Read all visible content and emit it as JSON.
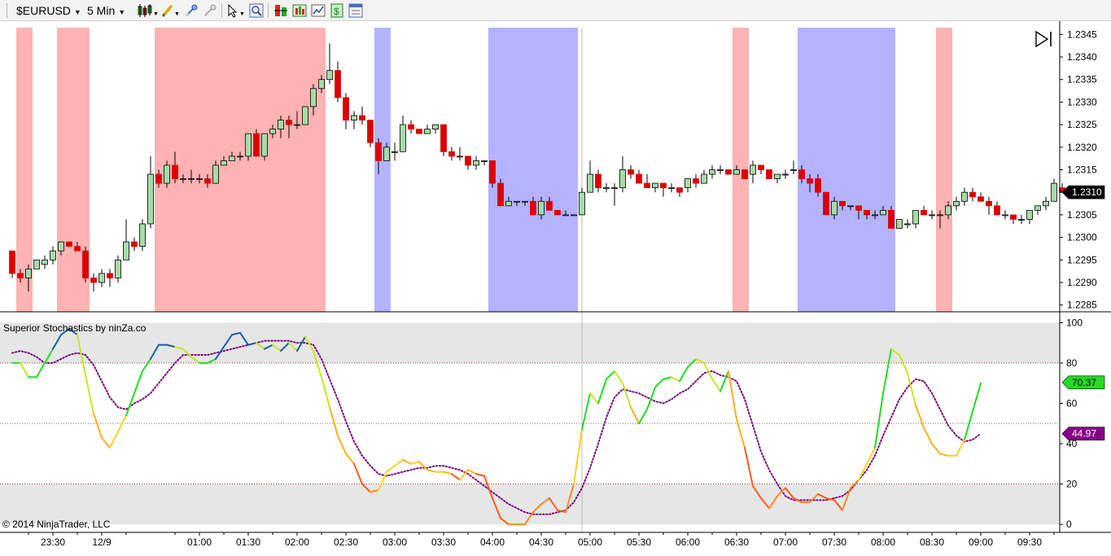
{
  "toolbar": {
    "instrument": "$EURUSD",
    "interval": "5 Min",
    "icons": [
      "bars-type-icon",
      "draw-tool-icon",
      "zoom-in-icon",
      "zoom-out-icon",
      "cursor-icon",
      "magnify-icon",
      "data-box-icon",
      "indicators-icon",
      "chart-style-icon",
      "strategy-icon",
      "properties-icon"
    ]
  },
  "colors": {
    "bull_fill": "#a6dca6",
    "bear_fill": "#dd0000",
    "pink_band": "#ffb3b3",
    "blue_band": "#b3b3ff",
    "zone_fill": "#e6e6e6",
    "signal_line": "#7a0a7a",
    "price_tag": "#000000",
    "k_tag": "#22dd22",
    "d_tag": "#880088"
  },
  "price_panel": {
    "y_labels": [
      "1.2345",
      "1.2340",
      "1.2335",
      "1.2330",
      "1.2325",
      "1.2320",
      "1.2315",
      "1.2310",
      "1.2305",
      "1.2300",
      "1.2295",
      "1.2290",
      "1.2285"
    ],
    "y_range": [
      1.22835,
      1.23465
    ],
    "current_price": "1.2310",
    "candles": [
      [
        1.2297,
        1.2297,
        1.2291,
        1.2292
      ],
      [
        1.2292,
        1.2293,
        1.229,
        1.2291
      ],
      [
        1.2291,
        1.2294,
        1.2288,
        1.2293
      ],
      [
        1.2293,
        1.2295,
        1.2293,
        1.2295
      ],
      [
        1.2294,
        1.2296,
        1.2293,
        1.2295
      ],
      [
        1.2295,
        1.2298,
        1.2294,
        1.2297
      ],
      [
        1.2297,
        1.2299,
        1.2296,
        1.2299
      ],
      [
        1.2299,
        1.2299,
        1.2298,
        1.2298
      ],
      [
        1.2298,
        1.2299,
        1.2297,
        1.2297
      ],
      [
        1.2297,
        1.2298,
        1.229,
        1.2291
      ],
      [
        1.2291,
        1.2292,
        1.2288,
        1.229
      ],
      [
        1.229,
        1.2293,
        1.2289,
        1.2292
      ],
      [
        1.2292,
        1.2293,
        1.2289,
        1.2291
      ],
      [
        1.2291,
        1.2296,
        1.229,
        1.2295
      ],
      [
        1.2295,
        1.2304,
        1.2295,
        1.2299
      ],
      [
        1.2299,
        1.23,
        1.2297,
        1.2298
      ],
      [
        1.2298,
        1.2304,
        1.2297,
        1.2303
      ],
      [
        1.2303,
        1.2318,
        1.2302,
        1.2314
      ],
      [
        1.2314,
        1.2315,
        1.2311,
        1.2312
      ],
      [
        1.2312,
        1.2317,
        1.2311,
        1.2316
      ],
      [
        1.2316,
        1.2319,
        1.2312,
        1.2313
      ],
      [
        1.2313,
        1.2314,
        1.2312,
        1.2313
      ],
      [
        1.2313,
        1.2315,
        1.2312,
        1.2313
      ],
      [
        1.2313,
        1.2314,
        1.2312,
        1.2313
      ],
      [
        1.2313,
        1.2314,
        1.2311,
        1.2312
      ],
      [
        1.2312,
        1.2317,
        1.2312,
        1.2316
      ],
      [
        1.2316,
        1.2318,
        1.2316,
        1.2317
      ],
      [
        1.2317,
        1.2319,
        1.2317,
        1.2318
      ],
      [
        1.2318,
        1.2319,
        1.2317,
        1.2318
      ],
      [
        1.2318,
        1.2323,
        1.2317,
        1.2323
      ],
      [
        1.2323,
        1.2324,
        1.2318,
        1.2318
      ],
      [
        1.2318,
        1.2323,
        1.2317,
        1.2323
      ],
      [
        1.2323,
        1.2325,
        1.2322,
        1.2324
      ],
      [
        1.2324,
        1.2327,
        1.2322,
        1.2326
      ],
      [
        1.2326,
        1.2327,
        1.2322,
        1.2325
      ],
      [
        1.2325,
        1.2328,
        1.2324,
        1.2325
      ],
      [
        1.2325,
        1.2329,
        1.2325,
        1.2329
      ],
      [
        1.2329,
        1.2334,
        1.2327,
        1.2333
      ],
      [
        1.2333,
        1.2336,
        1.2332,
        1.2335
      ],
      [
        1.2335,
        1.2343,
        1.2334,
        1.2337
      ],
      [
        1.2337,
        1.2339,
        1.233,
        1.2331
      ],
      [
        1.2331,
        1.2332,
        1.2324,
        1.2326
      ],
      [
        1.2326,
        1.2328,
        1.2324,
        1.2327
      ],
      [
        1.2327,
        1.2329,
        1.2325,
        1.2326
      ],
      [
        1.2326,
        1.2326,
        1.232,
        1.2321
      ],
      [
        1.2321,
        1.2322,
        1.2314,
        1.2317
      ],
      [
        1.2317,
        1.2321,
        1.2317,
        1.232
      ],
      [
        1.2319,
        1.2321,
        1.2317,
        1.2319
      ],
      [
        1.2319,
        1.2327,
        1.2319,
        1.2325
      ],
      [
        1.2325,
        1.2326,
        1.2323,
        1.2324
      ],
      [
        1.2324,
        1.2324,
        1.2323,
        1.2323
      ],
      [
        1.2323,
        1.2325,
        1.2323,
        1.2324
      ],
      [
        1.2324,
        1.2325,
        1.2323,
        1.2325
      ],
      [
        1.2325,
        1.2325,
        1.2318,
        1.2319
      ],
      [
        1.2319,
        1.232,
        1.2317,
        1.2318
      ],
      [
        1.2318,
        1.232,
        1.2317,
        1.2318
      ],
      [
        1.2318,
        1.2318,
        1.2315,
        1.2316
      ],
      [
        1.2316,
        1.2318,
        1.2315,
        1.2317
      ],
      [
        1.2317,
        1.2317,
        1.2316,
        1.2317
      ],
      [
        1.2317,
        1.2317,
        1.2311,
        1.2312
      ],
      [
        1.2312,
        1.2313,
        1.2307,
        1.2307
      ],
      [
        1.2307,
        1.2309,
        1.2307,
        1.2308
      ],
      [
        1.2308,
        1.2308,
        1.2307,
        1.2308
      ],
      [
        1.2308,
        1.2308,
        1.2307,
        1.2308
      ],
      [
        1.2308,
        1.2309,
        1.2305,
        1.2305
      ],
      [
        1.2305,
        1.2309,
        1.2304,
        1.2308
      ],
      [
        1.2308,
        1.2309,
        1.2306,
        1.2306
      ],
      [
        1.2306,
        1.2306,
        1.2305,
        1.2305
      ],
      [
        1.2305,
        1.2306,
        1.2305,
        1.2305
      ],
      [
        1.2305,
        1.2305,
        1.2305,
        1.2305
      ],
      [
        1.2305,
        1.2311,
        1.2305,
        1.231
      ],
      [
        1.231,
        1.2317,
        1.231,
        1.2314
      ],
      [
        1.2314,
        1.2315,
        1.231,
        1.2311
      ],
      [
        1.2311,
        1.2312,
        1.231,
        1.2311
      ],
      [
        1.2311,
        1.2312,
        1.2307,
        1.2311
      ],
      [
        1.2311,
        1.2318,
        1.231,
        1.2315
      ],
      [
        1.2315,
        1.2316,
        1.2313,
        1.2314
      ],
      [
        1.2314,
        1.2315,
        1.2312,
        1.2312
      ],
      [
        1.2312,
        1.2314,
        1.2311,
        1.2311
      ],
      [
        1.2311,
        1.2312,
        1.231,
        1.2312
      ],
      [
        1.2312,
        1.2312,
        1.2309,
        1.2311
      ],
      [
        1.2311,
        1.2312,
        1.231,
        1.2311
      ],
      [
        1.2311,
        1.2311,
        1.2309,
        1.231
      ],
      [
        1.2311,
        1.2313,
        1.231,
        1.2313
      ],
      [
        1.2313,
        1.2314,
        1.2311,
        1.2312
      ],
      [
        1.2312,
        1.2315,
        1.2312,
        1.2314
      ],
      [
        1.2314,
        1.2316,
        1.2313,
        1.2315
      ],
      [
        1.2315,
        1.2316,
        1.2314,
        1.2315
      ],
      [
        1.2315,
        1.2315,
        1.2314,
        1.2314
      ],
      [
        1.2314,
        1.2316,
        1.2314,
        1.2315
      ],
      [
        1.2315,
        1.2315,
        1.2313,
        1.2313
      ],
      [
        1.2314,
        1.2317,
        1.2312,
        1.2316
      ],
      [
        1.2316,
        1.2316,
        1.2314,
        1.2315
      ],
      [
        1.2315,
        1.2315,
        1.2313,
        1.2313
      ],
      [
        1.2313,
        1.2314,
        1.2312,
        1.2314
      ],
      [
        1.2314,
        1.2315,
        1.2313,
        1.2314
      ],
      [
        1.2315,
        1.2317,
        1.2314,
        1.2315
      ],
      [
        1.2315,
        1.2316,
        1.2312,
        1.2313
      ],
      [
        1.2313,
        1.2314,
        1.231,
        1.2312
      ],
      [
        1.2313,
        1.2314,
        1.2309,
        1.231
      ],
      [
        1.231,
        1.231,
        1.2305,
        1.2305
      ],
      [
        1.2305,
        1.2309,
        1.2304,
        1.2308
      ],
      [
        1.2308,
        1.2308,
        1.2306,
        1.2307
      ],
      [
        1.2307,
        1.2307,
        1.2306,
        1.2307
      ],
      [
        1.2307,
        1.2307,
        1.2304,
        1.2306
      ],
      [
        1.2306,
        1.2306,
        1.2304,
        1.2305
      ],
      [
        1.2305,
        1.2306,
        1.2304,
        1.2305
      ],
      [
        1.2305,
        1.2307,
        1.2305,
        1.2306
      ],
      [
        1.2306,
        1.2307,
        1.2302,
        1.2302
      ],
      [
        1.2302,
        1.2304,
        1.2302,
        1.2304
      ],
      [
        1.2303,
        1.2304,
        1.2302,
        1.2303
      ],
      [
        1.2303,
        1.2306,
        1.2302,
        1.2306
      ],
      [
        1.2306,
        1.2307,
        1.2305,
        1.2305
      ],
      [
        1.2305,
        1.2306,
        1.2304,
        1.2305
      ],
      [
        1.2305,
        1.2306,
        1.2302,
        1.2305
      ],
      [
        1.2305,
        1.2308,
        1.2304,
        1.2307
      ],
      [
        1.2307,
        1.2309,
        1.2306,
        1.2308
      ],
      [
        1.2308,
        1.2311,
        1.2307,
        1.231
      ],
      [
        1.231,
        1.2311,
        1.2308,
        1.2309
      ],
      [
        1.2309,
        1.231,
        1.2308,
        1.2308
      ],
      [
        1.2308,
        1.2309,
        1.2305,
        1.2307
      ],
      [
        1.2307,
        1.2308,
        1.2305,
        1.2305
      ],
      [
        1.2305,
        1.2306,
        1.2304,
        1.2305
      ],
      [
        1.2305,
        1.2305,
        1.2303,
        1.2304
      ],
      [
        1.2304,
        1.2305,
        1.2303,
        1.2304
      ],
      [
        1.2304,
        1.2306,
        1.2303,
        1.2306
      ],
      [
        1.2306,
        1.2307,
        1.2305,
        1.2307
      ],
      [
        1.2307,
        1.2309,
        1.2306,
        1.2308
      ],
      [
        1.2308,
        1.2313,
        1.2308,
        1.2312
      ],
      [
        1.2311,
        1.2312,
        1.231,
        1.231
      ]
    ]
  },
  "bands": [
    {
      "from": 1,
      "to": 2,
      "color": "pink"
    },
    {
      "from": 6,
      "to": 9,
      "color": "pink"
    },
    {
      "from": 18,
      "to": 38,
      "color": "pink"
    },
    {
      "from": 45,
      "to": 46,
      "color": "blue"
    },
    {
      "from": 59,
      "to": 69,
      "color": "blue"
    },
    {
      "from": 89,
      "to": 90,
      "color": "pink"
    },
    {
      "from": 97,
      "to": 108,
      "color": "blue"
    },
    {
      "from": 114,
      "to": 115,
      "color": "pink"
    }
  ],
  "indicator_panel": {
    "title": "Superior Stochastics by ninZa.co",
    "y_labels": [
      "100",
      "80",
      "60",
      "40",
      "20",
      "0"
    ],
    "y_range": [
      -4,
      105
    ],
    "k_value": "70.37",
    "d_value": "44.97",
    "k": [
      80,
      80,
      73,
      73,
      80,
      87,
      94,
      97,
      94,
      74,
      55,
      43,
      38,
      46,
      54,
      65,
      76,
      82,
      89,
      89,
      88,
      87,
      83,
      80,
      80,
      82,
      88,
      94,
      95,
      89,
      90,
      87,
      89,
      86,
      90,
      86,
      93,
      86,
      73,
      58,
      44,
      35,
      30,
      20,
      16,
      17,
      26,
      29,
      32,
      30,
      31,
      27,
      26,
      26,
      25,
      22,
      27,
      25,
      24,
      13,
      3,
      0,
      0,
      0,
      6,
      10,
      13,
      7,
      6,
      20,
      47,
      65,
      60,
      72,
      76,
      70,
      58,
      50,
      57,
      68,
      72,
      73,
      71,
      78,
      82,
      80,
      72,
      66,
      76,
      52,
      38,
      19,
      13,
      8,
      14,
      18,
      13,
      11,
      11,
      15,
      13,
      12,
      7,
      18,
      22,
      30,
      38,
      65,
      87,
      84,
      75,
      59,
      48,
      40,
      35,
      34,
      34,
      42,
      56,
      70
    ],
    "d": [
      85,
      86,
      85,
      83,
      80,
      80,
      82,
      84,
      85,
      84,
      79,
      71,
      63,
      58,
      57,
      60,
      62,
      65,
      70,
      75,
      80,
      84,
      84,
      84,
      84,
      85,
      86,
      87,
      88,
      89,
      90,
      91,
      91,
      91,
      91,
      90,
      90,
      89,
      82,
      72,
      62,
      51,
      41,
      34,
      29,
      25,
      24,
      25,
      26,
      27,
      28,
      28,
      29,
      29,
      28,
      27,
      25,
      22,
      19,
      16,
      13,
      10,
      8,
      6,
      5,
      5,
      5,
      6,
      7,
      11,
      18,
      28,
      40,
      53,
      63,
      67,
      66,
      65,
      63,
      61,
      60,
      62,
      65,
      67,
      71,
      75,
      76,
      74,
      73,
      71,
      62,
      49,
      36,
      27,
      20,
      14,
      12,
      12,
      12,
      12,
      12,
      13,
      14,
      17,
      22,
      27,
      34,
      44,
      53,
      62,
      68,
      72,
      71,
      65,
      57,
      49,
      44,
      41,
      42,
      45
    ]
  },
  "x_labels": [
    {
      "i": 5,
      "t": "23:30"
    },
    {
      "i": 11,
      "t": "12/9"
    },
    {
      "i": 23,
      "t": "01:00"
    },
    {
      "i": 29,
      "t": "01:30"
    },
    {
      "i": 35,
      "t": "02:00"
    },
    {
      "i": 41,
      "t": "02:30"
    },
    {
      "i": 47,
      "t": "03:00"
    },
    {
      "i": 53,
      "t": "03:30"
    },
    {
      "i": 59,
      "t": "04:00"
    },
    {
      "i": 65,
      "t": "04:30"
    },
    {
      "i": 71,
      "t": "05:00"
    },
    {
      "i": 77,
      "t": "05:30"
    },
    {
      "i": 83,
      "t": "06:00"
    },
    {
      "i": 89,
      "t": "06:30"
    },
    {
      "i": 95,
      "t": "07:00"
    },
    {
      "i": 101,
      "t": "07:30"
    },
    {
      "i": 107,
      "t": "08:00"
    },
    {
      "i": 113,
      "t": "08:30"
    },
    {
      "i": 119,
      "t": "09:00"
    },
    {
      "i": 125,
      "t": "09:30"
    }
  ],
  "copyright": "© 2014 NinjaTrader, LLC"
}
